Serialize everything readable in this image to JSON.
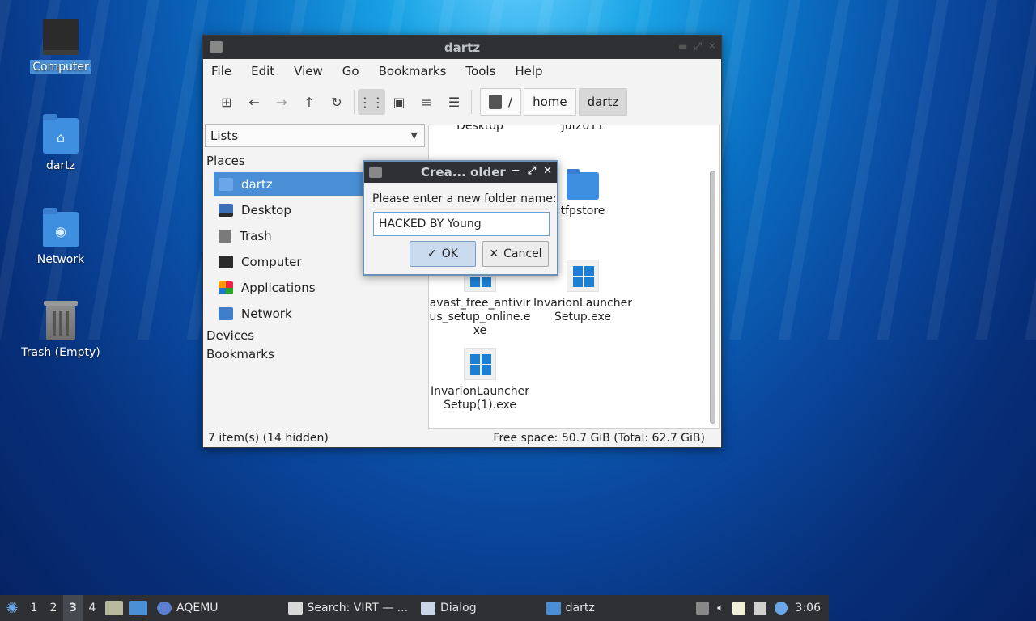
{
  "desktop": {
    "icons": [
      {
        "label": "Computer",
        "icon": "computer-icon"
      },
      {
        "label": "dartz",
        "icon": "home-folder-icon"
      },
      {
        "label": "Network",
        "icon": "network-icon"
      },
      {
        "label": "Trash (Empty)",
        "icon": "trash-icon"
      }
    ]
  },
  "window": {
    "title": "dartz",
    "menu": [
      "File",
      "Edit",
      "View",
      "Go",
      "Bookmarks",
      "Tools",
      "Help"
    ],
    "path": {
      "root": "/",
      "segments": [
        "home",
        "dartz"
      ]
    },
    "sidebar": {
      "combo_value": "Lists",
      "places_header": "Places",
      "places": [
        "dartz",
        "Desktop",
        "Trash",
        "Computer",
        "Applications",
        "Network"
      ],
      "devices_header": "Devices",
      "bookmarks_header": "Bookmarks"
    },
    "files": {
      "top_partial": [
        "Desktop",
        "jul2011"
      ],
      "folder": "tfpstore",
      "exe1": "avast_free_antivirus_setup_online.exe",
      "exe2": "InvarionLauncherSetup.exe",
      "exe3": "InvarionLauncherSetup(1).exe"
    },
    "status": {
      "left": "7 item(s) (14 hidden)",
      "right": "Free space: 50.7 GiB (Total: 62.7 GiB)"
    }
  },
  "dialog": {
    "title": "Crea... older",
    "prompt": "Please enter a new folder name:",
    "input_value": "HACKED BY Young",
    "ok_label": "OK",
    "cancel_label": "Cancel"
  },
  "taskbar": {
    "workspaces": [
      "1",
      "2",
      "3",
      "4"
    ],
    "active_workspace": "3",
    "tasks": [
      "AQEMU",
      "Search: VIRT — ...",
      "Dialog",
      "dartz"
    ],
    "clock": "3:06"
  }
}
